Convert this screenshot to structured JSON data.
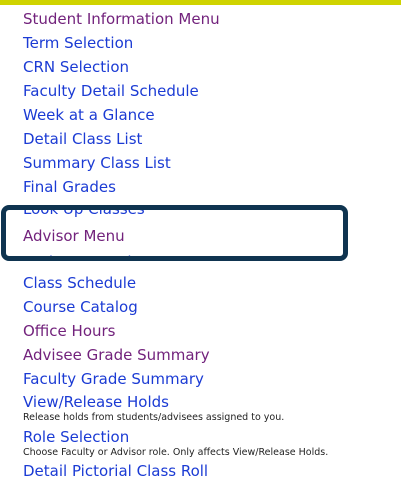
{
  "colors": {
    "top_bar": "#cfd300",
    "visited_link": "#72227c",
    "link": "#1b3bd4",
    "highlight_border": "#0f3450"
  },
  "menu": {
    "student_info": "Student Information Menu",
    "term_selection": "Term Selection",
    "crn_selection": "CRN Selection",
    "faculty_detail_schedule": "Faculty Detail Schedule",
    "week_at_a_glance": "Week at a Glance",
    "detail_class_list": "Detail Class List",
    "summary_class_list": "Summary Class List",
    "final_grades": "Final Grades",
    "look_up_classes": "Look Up Classes",
    "advisor_menu": "Advisor Menu",
    "assignment_history": "Assignment History",
    "class_schedule": "Class Schedule",
    "course_catalog": "Course Catalog",
    "office_hours": "Office Hours",
    "advisee_grade_summary": "Advisee Grade Summary",
    "faculty_grade_summary": "Faculty Grade Summary",
    "view_release_holds": "View/Release Holds",
    "view_release_holds_desc": "Release holds from students/advisees assigned to you.",
    "role_selection": "Role Selection",
    "role_selection_desc": "Choose Faculty or Advisor role. Only affects View/Release Holds.",
    "detail_pictorial_class_roll": "Detail Pictorial Class Roll"
  }
}
